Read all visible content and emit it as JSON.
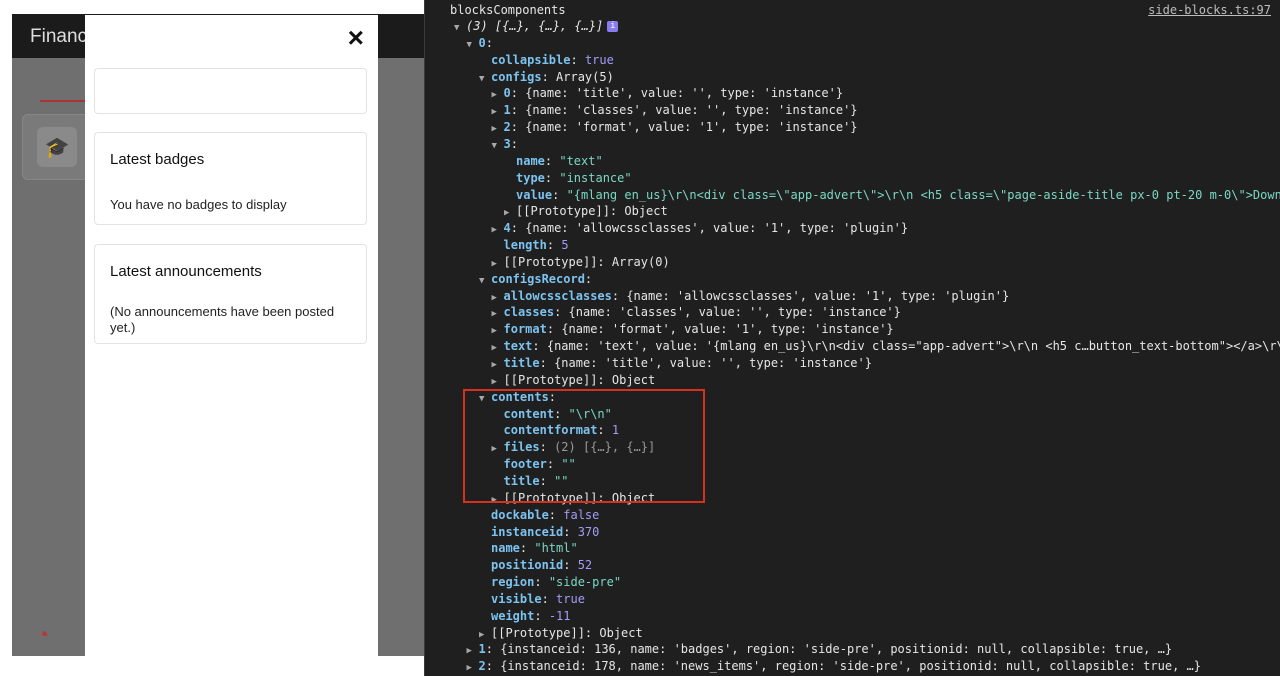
{
  "app": {
    "title": "Financ"
  },
  "drawer": {
    "close_label": "×",
    "badges": {
      "title": "Latest badges",
      "text": "You have no badges to display"
    },
    "announcements": {
      "title": "Latest announcements",
      "text": "(No announcements have been posted yet.)"
    }
  },
  "console": {
    "label": "blocksComponents",
    "source_link": "side-blocks.ts:97",
    "lines": [
      {
        "i": 0,
        "t": "open",
        "h": "(3) [{…}, {…}, {…}]",
        "c": "it",
        "info": true
      },
      {
        "i": 1,
        "t": "open",
        "k": "0",
        "s": ":"
      },
      {
        "i": 2,
        "k": "collapsible",
        "s": ": ",
        "v": "true",
        "c": "kw"
      },
      {
        "i": 2,
        "t": "open",
        "k": "configs",
        "s": ": ",
        "v": "Array(5)",
        "c": "plain"
      },
      {
        "i": 3,
        "t": "closed",
        "k": "0",
        "s": ": ",
        "v": "{name: 'title', value: '', type: 'instance'}",
        "c": "plain"
      },
      {
        "i": 3,
        "t": "closed",
        "k": "1",
        "s": ": ",
        "v": "{name: 'classes', value: '', type: 'instance'}",
        "c": "plain"
      },
      {
        "i": 3,
        "t": "closed",
        "k": "2",
        "s": ": ",
        "v": "{name: 'format', value: '1', type: 'instance'}",
        "c": "plain"
      },
      {
        "i": 3,
        "t": "open",
        "k": "3",
        "s": ":"
      },
      {
        "i": 4,
        "k": "name",
        "s": ": ",
        "v": "\"text\"",
        "c": "str"
      },
      {
        "i": 4,
        "k": "type",
        "s": ": ",
        "v": "\"instance\"",
        "c": "str"
      },
      {
        "i": 4,
        "k": "value",
        "s": ": ",
        "v": "\"{mlang en_us}\\r\\n<div class=\\\"app-advert\\\">\\r\\n    <h5 class=\\\"page-aside-title px-0 pt-20 m-0\\\">Down",
        "c": "str"
      },
      {
        "i": 4,
        "t": "closed",
        "k": "[[Prototype]]",
        "s": ": ",
        "v": "Object",
        "c": "plain",
        "nk": true
      },
      {
        "i": 3,
        "t": "closed",
        "k": "4",
        "s": ": ",
        "v": "{name: 'allowcssclasses', value: '1', type: 'plugin'}",
        "c": "plain"
      },
      {
        "i": 3,
        "k": "length",
        "s": ": ",
        "v": "5",
        "c": "num"
      },
      {
        "i": 3,
        "t": "closed",
        "k": "[[Prototype]]",
        "s": ": ",
        "v": "Array(0)",
        "c": "plain",
        "nk": true
      },
      {
        "i": 2,
        "t": "open",
        "k": "configsRecord",
        "s": ":"
      },
      {
        "i": 3,
        "t": "closed",
        "k": "allowcssclasses",
        "s": ": ",
        "v": "{name: 'allowcssclasses', value: '1', type: 'plugin'}",
        "c": "plain"
      },
      {
        "i": 3,
        "t": "closed",
        "k": "classes",
        "s": ": ",
        "v": "{name: 'classes', value: '', type: 'instance'}",
        "c": "plain"
      },
      {
        "i": 3,
        "t": "closed",
        "k": "format",
        "s": ": ",
        "v": "{name: 'format', value: '1', type: 'instance'}",
        "c": "plain"
      },
      {
        "i": 3,
        "t": "closed",
        "k": "text",
        "s": ": ",
        "v": "{name: 'text', value: '{mlang en_us}\\r\\n<div class=\"app-advert\">\\r\\n    <h5 c…button_text-bottom\"></a>\\r\\",
        "c": "plain"
      },
      {
        "i": 3,
        "t": "closed",
        "k": "title",
        "s": ": ",
        "v": "{name: 'title', value: '', type: 'instance'}",
        "c": "plain"
      },
      {
        "i": 3,
        "t": "closed",
        "k": "[[Prototype]]",
        "s": ": ",
        "v": "Object",
        "c": "plain",
        "nk": true
      },
      {
        "i": 2,
        "t": "open",
        "k": "contents",
        "s": ":"
      },
      {
        "i": 3,
        "k": "content",
        "s": ": ",
        "v": "\"\\r\\n\"",
        "c": "str"
      },
      {
        "i": 3,
        "k": "contentformat",
        "s": ": ",
        "v": "1",
        "c": "num"
      },
      {
        "i": 3,
        "t": "closed",
        "k": "files",
        "s": ": ",
        "v": "(2) [{…}, {…}]",
        "c": "dim"
      },
      {
        "i": 3,
        "k": "footer",
        "s": ": ",
        "v": "\"\"",
        "c": "str"
      },
      {
        "i": 3,
        "k": "title",
        "s": ": ",
        "v": "\"\"",
        "c": "str"
      },
      {
        "i": 3,
        "t": "closed",
        "k": "[[Prototype]]",
        "s": ": ",
        "v": "Object",
        "c": "plain",
        "nk": true
      },
      {
        "i": 2,
        "k": "dockable",
        "s": ": ",
        "v": "false",
        "c": "kw"
      },
      {
        "i": 2,
        "k": "instanceid",
        "s": ": ",
        "v": "370",
        "c": "num"
      },
      {
        "i": 2,
        "k": "name",
        "s": ": ",
        "v": "\"html\"",
        "c": "str"
      },
      {
        "i": 2,
        "k": "positionid",
        "s": ": ",
        "v": "52",
        "c": "num"
      },
      {
        "i": 2,
        "k": "region",
        "s": ": ",
        "v": "\"side-pre\"",
        "c": "str"
      },
      {
        "i": 2,
        "k": "visible",
        "s": ": ",
        "v": "true",
        "c": "kw"
      },
      {
        "i": 2,
        "k": "weight",
        "s": ": ",
        "v": "-11",
        "c": "num"
      },
      {
        "i": 2,
        "t": "closed",
        "k": "[[Prototype]]",
        "s": ": ",
        "v": "Object",
        "c": "plain",
        "nk": true
      },
      {
        "i": 1,
        "t": "closed",
        "k": "1",
        "s": ": ",
        "v": "{instanceid: 136, name: 'badges', region: 'side-pre', positionid: null, collapsible: true, …}",
        "c": "plain"
      },
      {
        "i": 1,
        "t": "closed",
        "k": "2",
        "s": ": ",
        "v": "{instanceid: 178, name: 'news_items', region: 'side-pre', positionid: null, collapsible: true, …}",
        "c": "plain"
      }
    ]
  },
  "colors": {
    "highlight": "#d8301f",
    "console_bg": "#1f1f1f",
    "key": "#7cc3f0",
    "string": "#7ad8c4",
    "number": "#a39cf7"
  },
  "icons": {
    "close": "close-icon",
    "card": "graduation-cap-icon",
    "bottom": "dashboard-icon",
    "info": "info-icon"
  }
}
